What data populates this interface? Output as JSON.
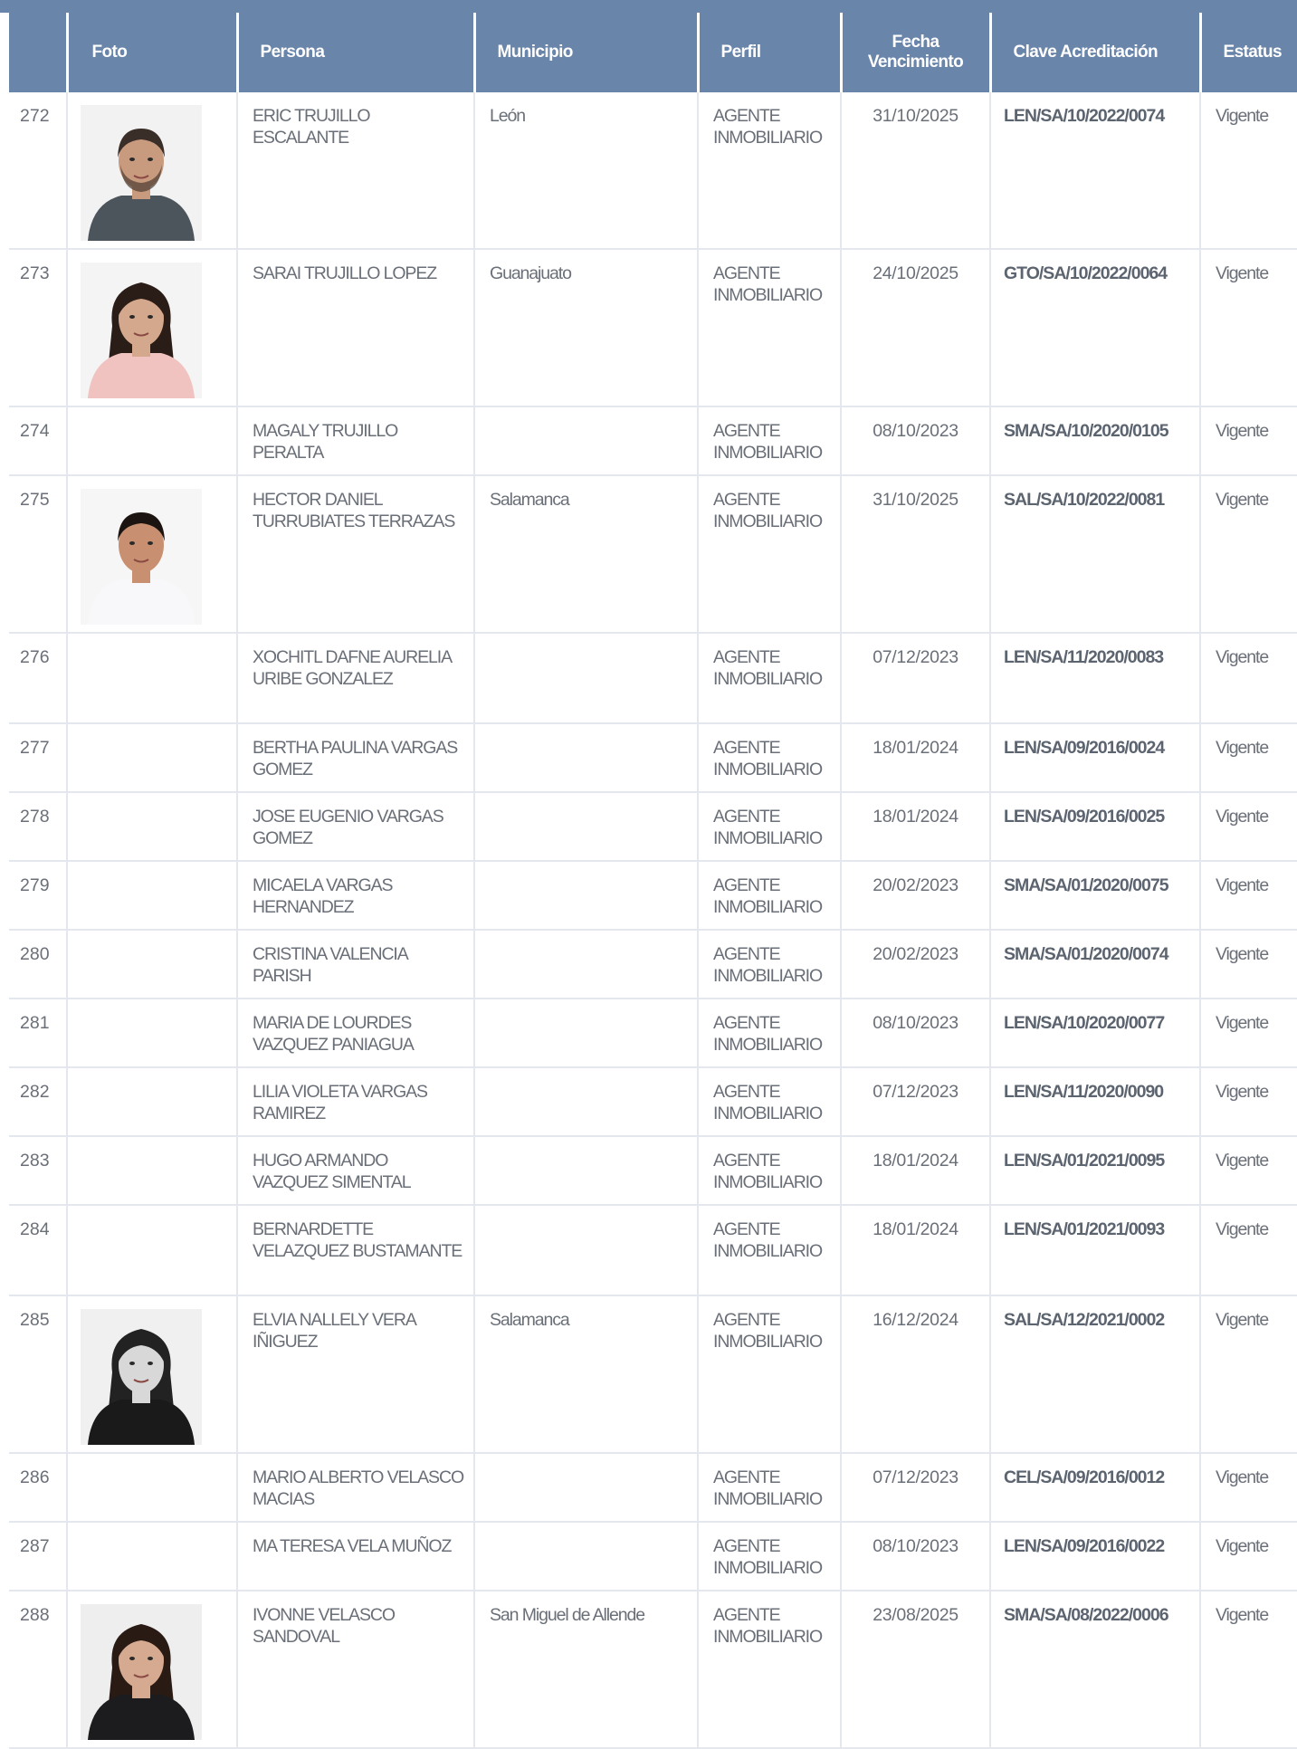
{
  "table": {
    "headers": {
      "num": "",
      "foto": "Foto",
      "persona": "Persona",
      "municipio": "Municipio",
      "perfil": "Perfil",
      "fecha_line1": "Fecha",
      "fecha_line2": "Vencimiento",
      "clave": "Clave Acreditación",
      "estatus": "Estatus"
    },
    "rows": [
      {
        "num": "272",
        "persona": "ERIC TRUJILLO ESCALANTE",
        "municipio": "León",
        "perfil": "AGENTE INMOBILIARIO",
        "fecha": "31/10/2025",
        "clave": "LEN/SA/10/2022/0074",
        "estatus": "Vigente",
        "photo": "man-gray-shirt"
      },
      {
        "num": "273",
        "persona": "SARAI TRUJILLO LOPEZ",
        "municipio": "Guanajuato",
        "perfil": "AGENTE INMOBILIARIO",
        "fecha": "24/10/2025",
        "clave": "GTO/SA/10/2022/0064",
        "estatus": "Vigente",
        "photo": "woman-pink-top"
      },
      {
        "num": "274",
        "persona": "MAGALY TRUJILLO PERALTA",
        "municipio": "",
        "perfil": "AGENTE INMOBILIARIO",
        "fecha": "08/10/2023",
        "clave": "SMA/SA/10/2020/0105",
        "estatus": "Vigente",
        "photo": ""
      },
      {
        "num": "275",
        "persona": "HECTOR DANIEL TURRUBIATES TERRAZAS",
        "municipio": "Salamanca",
        "perfil": "AGENTE INMOBILIARIO",
        "fecha": "31/10/2025",
        "clave": "SAL/SA/10/2022/0081",
        "estatus": "Vigente",
        "photo": "man-white-shirt"
      },
      {
        "num": "276",
        "persona": "XOCHITL DAFNE AURELIA URIBE GONZALEZ",
        "municipio": "",
        "perfil": "AGENTE INMOBILIARIO",
        "fecha": "07/12/2023",
        "clave": "LEN/SA/11/2020/0083",
        "estatus": "Vigente",
        "photo": ""
      },
      {
        "num": "277",
        "persona": "BERTHA PAULINA VARGAS GOMEZ",
        "municipio": "",
        "perfil": "AGENTE INMOBILIARIO",
        "fecha": "18/01/2024",
        "clave": "LEN/SA/09/2016/0024",
        "estatus": "Vigente",
        "photo": ""
      },
      {
        "num": "278",
        "persona": "JOSE EUGENIO VARGAS GOMEZ",
        "municipio": "",
        "perfil": "AGENTE INMOBILIARIO",
        "fecha": "18/01/2024",
        "clave": "LEN/SA/09/2016/0025",
        "estatus": "Vigente",
        "photo": ""
      },
      {
        "num": "279",
        "persona": "MICAELA VARGAS HERNANDEZ",
        "municipio": "",
        "perfil": "AGENTE INMOBILIARIO",
        "fecha": "20/02/2023",
        "clave": "SMA/SA/01/2020/0075",
        "estatus": "Vigente",
        "photo": ""
      },
      {
        "num": "280",
        "persona": "CRISTINA VALENCIA PARISH",
        "municipio": "",
        "perfil": "AGENTE INMOBILIARIO",
        "fecha": "20/02/2023",
        "clave": "SMA/SA/01/2020/0074",
        "estatus": "Vigente",
        "photo": ""
      },
      {
        "num": "281",
        "persona": "MARIA DE LOURDES VAZQUEZ PANIAGUA",
        "municipio": "",
        "perfil": "AGENTE INMOBILIARIO",
        "fecha": "08/10/2023",
        "clave": "LEN/SA/10/2020/0077",
        "estatus": "Vigente",
        "photo": ""
      },
      {
        "num": "282",
        "persona": "LILIA VIOLETA VARGAS RAMIREZ",
        "municipio": "",
        "perfil": "AGENTE INMOBILIARIO",
        "fecha": "07/12/2023",
        "clave": "LEN/SA/11/2020/0090",
        "estatus": "Vigente",
        "photo": ""
      },
      {
        "num": "283",
        "persona": "HUGO ARMANDO VAZQUEZ SIMENTAL",
        "municipio": "",
        "perfil": "AGENTE INMOBILIARIO",
        "fecha": "18/01/2024",
        "clave": "LEN/SA/01/2021/0095",
        "estatus": "Vigente",
        "photo": ""
      },
      {
        "num": "284",
        "persona": "BERNARDETTE VELAZQUEZ BUSTAMANTE",
        "municipio": "",
        "perfil": "AGENTE INMOBILIARIO",
        "fecha": "18/01/2024",
        "clave": "LEN/SA/01/2021/0093",
        "estatus": "Vigente",
        "photo": ""
      },
      {
        "num": "285",
        "persona": "ELVIA NALLELY VERA IÑIGUEZ",
        "municipio": "Salamanca",
        "perfil": "AGENTE INMOBILIARIO",
        "fecha": "16/12/2024",
        "clave": "SAL/SA/12/2021/0002",
        "estatus": "Vigente",
        "photo": "woman-bw"
      },
      {
        "num": "286",
        "persona": "MARIO ALBERTO VELASCO MACIAS",
        "municipio": "",
        "perfil": "AGENTE INMOBILIARIO",
        "fecha": "07/12/2023",
        "clave": "CEL/SA/09/2016/0012",
        "estatus": "Vigente",
        "photo": ""
      },
      {
        "num": "287",
        "persona": "MA TERESA VELA MUÑOZ",
        "municipio": "",
        "perfil": "AGENTE INMOBILIARIO",
        "fecha": "08/10/2023",
        "clave": "LEN/SA/09/2016/0022",
        "estatus": "Vigente",
        "photo": ""
      },
      {
        "num": "288",
        "persona": "IVONNE VELASCO SANDOVAL",
        "municipio": "San Miguel de Allende",
        "perfil": "AGENTE INMOBILIARIO",
        "fecha": "23/08/2025",
        "clave": "SMA/SA/08/2022/0006",
        "estatus": "Vigente",
        "photo": "woman-black-blouse"
      }
    ]
  }
}
